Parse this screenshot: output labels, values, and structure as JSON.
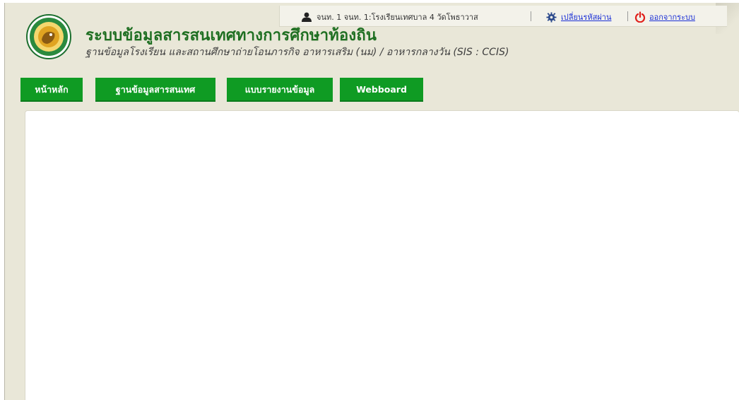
{
  "header": {
    "title": "ระบบข้อมูลสารสนเทศทางการศึกษาท้องถิ่น",
    "subtitle": "ฐานข้อมูลโรงเรียน และสถานศึกษาถ่ายโอนภารกิจ อาหารเสริม (นม) / อาหารกลางวัน (SIS : CCIS)",
    "logo_icon": "local-administration-seal"
  },
  "topbar": {
    "user_text": "จนท. 1 จนท. 1:โรงเรียนเทศบาล 4 วัดโพธาวาส",
    "change_password": "เปลี่ยนรหัสผ่าน",
    "logout": "ออกจากระบบ",
    "user_icon": "user-icon",
    "gear_icon": "gear-icon",
    "power_icon": "power-icon"
  },
  "nav": {
    "items": [
      {
        "label": "หน้าหลัก"
      },
      {
        "label": "ฐานข้อมูลสารสนเทศ"
      },
      {
        "label": "แบบรายงานข้อมูล"
      },
      {
        "label": "Webboard"
      }
    ]
  },
  "colors": {
    "nav_green": "#0f9b23",
    "title_green": "#1f6f22",
    "page_bg": "#e9e7d8",
    "link_blue": "#1a2fd6",
    "power_red": "#e0201b"
  }
}
